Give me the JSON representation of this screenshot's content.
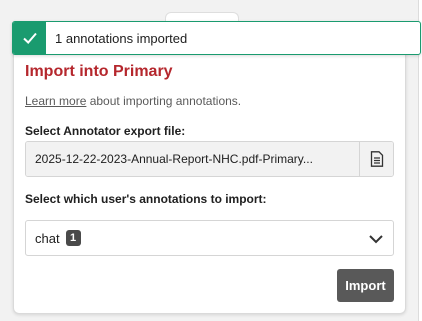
{
  "toast": {
    "message": "1 annotations imported",
    "icon": "check-icon",
    "color": "#1a9b6f"
  },
  "panel": {
    "title": "Import into Primary",
    "learn_more_link": "Learn more",
    "learn_more_rest": " about importing annotations.",
    "file_label": "Select Annotator export file:",
    "file_name": "2025-12-22-2023-Annual-Report-NHC.pdf-Primary...",
    "file_button_icon": "file-icon",
    "user_label": "Select which user's annotations to import:",
    "user_select": {
      "value": "chat",
      "count": "1"
    },
    "import_label": "Import"
  },
  "colors": {
    "title": "#b5272d",
    "button": "#595959",
    "success": "#1a9b6f"
  }
}
